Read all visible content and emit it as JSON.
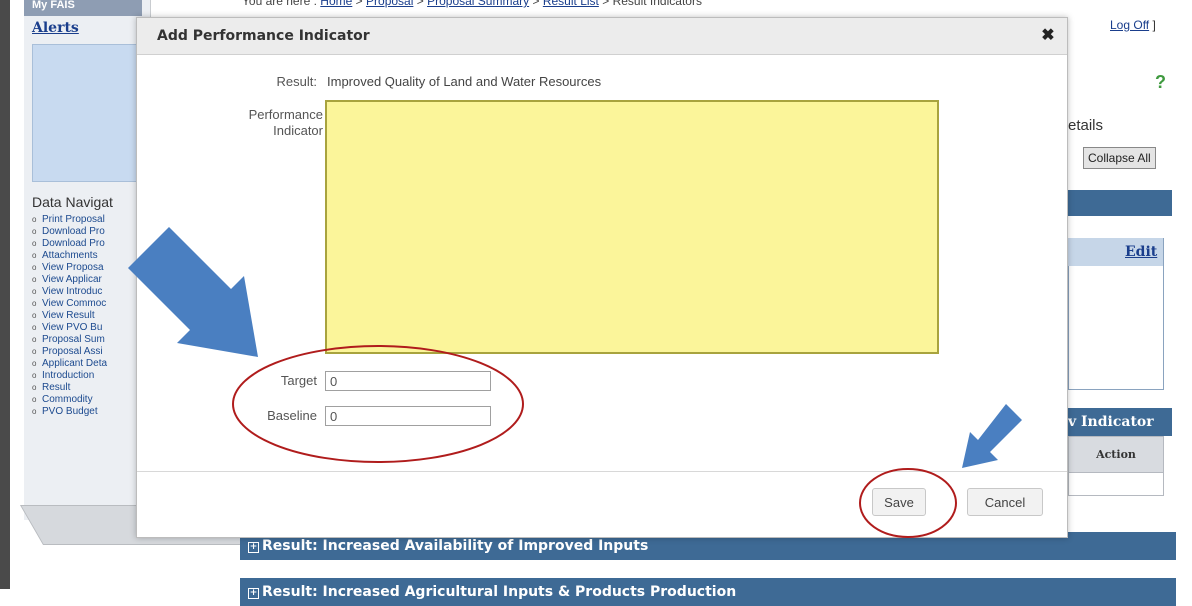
{
  "app": {
    "my_fais_label": "My FAIS",
    "alerts_label": "Alerts",
    "breadcrumb": {
      "prefix": "You are here :",
      "items": [
        "Home",
        "Proposal",
        "Proposal Summary",
        "Result List",
        "Result Indicators"
      ],
      "separator": ">"
    },
    "logoff_label": "Log Off",
    "logoff_bracket": "]",
    "help_label": "?"
  },
  "sidebar": {
    "data_navigation_title": "Data Navigat",
    "items": [
      "Print Proposal",
      "Download Pro",
      "Download Pro",
      "Attachments",
      "View Proposa",
      "View Applicar",
      "View Introduc",
      "View Commoc",
      "View Result",
      "View PVO Bu",
      "Proposal Sum",
      "Proposal Assi",
      "Applicant Deta",
      "Introduction",
      "Result",
      "Commodity",
      "PVO Budget"
    ]
  },
  "right_panel": {
    "details_label": "etails",
    "collapse_all_label": "Collapse All",
    "edit_label": "Edit",
    "indicator_label": "v Indicator",
    "action_label": "Action"
  },
  "sections": [
    {
      "label": "Result: Increased Availability of Improved Inputs"
    },
    {
      "label": "Result: Increased Agricultural Inputs & Products Production"
    }
  ],
  "modal": {
    "title": "Add Performance Indicator",
    "close_label": "✖",
    "result_label": "Result:",
    "result_value": "Improved Quality of Land and Water Resources",
    "performance_indicator_label_line1": "Performance",
    "performance_indicator_label_line2": "Indicator",
    "performance_indicator_value": "",
    "target_label": "Target",
    "target_value": "0",
    "baseline_label": "Baseline",
    "baseline_value": "0",
    "save_label": "Save",
    "cancel_label": "Cancel"
  },
  "colors": {
    "accent_blue": "#3e6a95",
    "textarea_yellow": "#fbf59a",
    "annotation_arrow": "#4a7fc1",
    "annotation_circle": "#b01c1c"
  }
}
